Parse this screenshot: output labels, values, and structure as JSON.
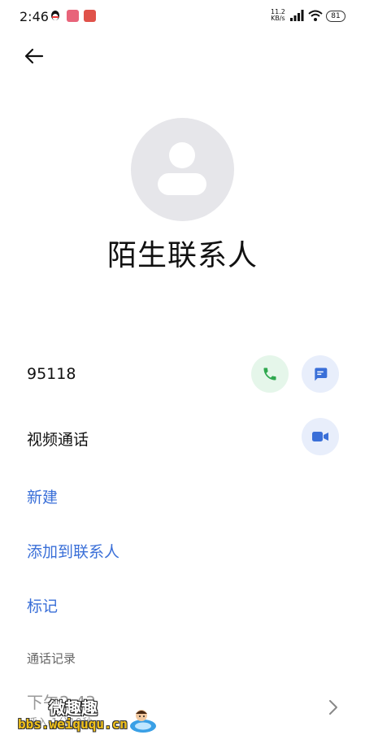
{
  "status_bar": {
    "time": "2:46",
    "net_speed_value": "11.2",
    "net_speed_unit": "KB/s",
    "battery": "81",
    "notification_icons": [
      "qq-icon",
      "app-notification-icon",
      "app-notification-icon"
    ]
  },
  "contact": {
    "name": "陌生联系人",
    "phone": "95118",
    "video_call_label": "视频通话"
  },
  "actions": {
    "new_label": "新建",
    "add_to_contacts_label": "添加到联系人",
    "mark_label": "标记"
  },
  "call_log": {
    "section_title": "通话记录",
    "entries": [
      {
        "time": "下午2:43",
        "detail": "呼入 1分10秒"
      }
    ]
  },
  "watermark": {
    "title": "微趣趣",
    "url": "bbs.weiququ.cn"
  },
  "colors": {
    "accent": "#3a6fd8",
    "call_green": "#2fa84f",
    "avatar_bg": "#e6e6ea"
  }
}
